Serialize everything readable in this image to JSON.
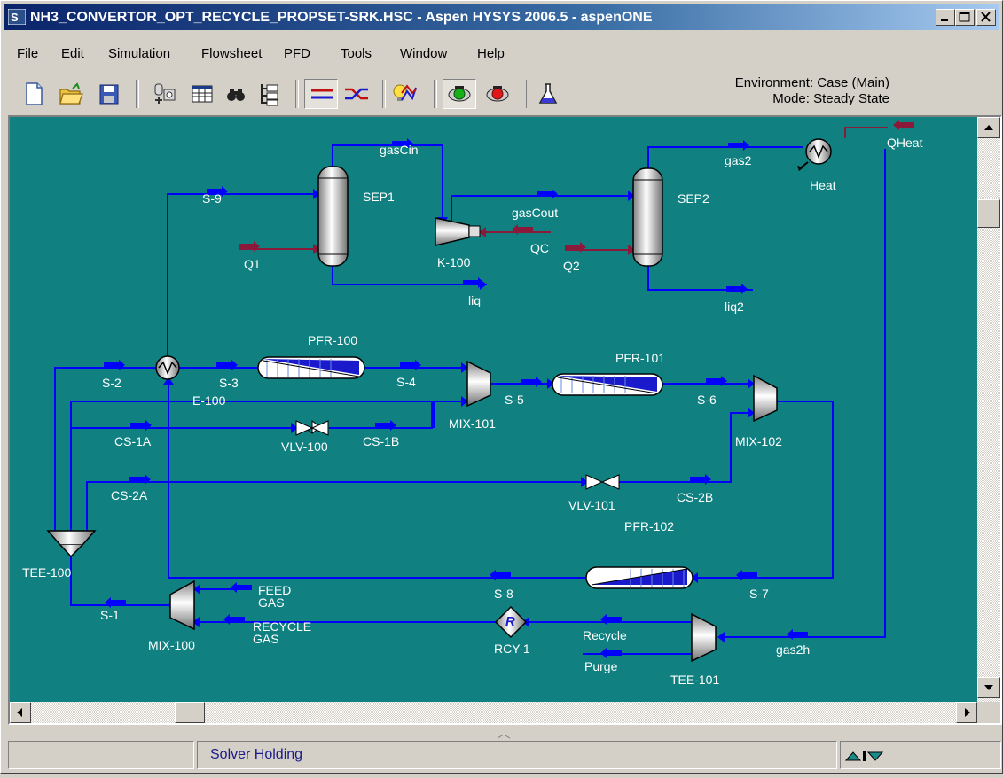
{
  "window": {
    "title": "NH3_CONVERTOR_OPT_RECYCLE_PROPSET-SRK.HSC - Aspen HYSYS 2006.5 - aspenONE",
    "controls": [
      "minimize-icon",
      "maximize-icon",
      "close-icon"
    ]
  },
  "menu": [
    "File",
    "Edit",
    "Simulation",
    "Flowsheet",
    "PFD",
    "Tools",
    "Window",
    "Help"
  ],
  "toolbar": {
    "icons": [
      "new-file-icon",
      "open-folder-icon",
      "save-disk-icon",
      "object-palette-icon",
      "workbook-icon",
      "find-binoculars-icon",
      "navigator-tree-icon",
      "pfd-streams-icon",
      "pfd-crossover-icon",
      "optimizer-icon",
      "solver-active-icon",
      "solver-hold-icon",
      "flask-icon"
    ],
    "environment": "Environment: Case (Main)",
    "mode": "Mode: Steady State"
  },
  "flowsheet": {
    "streams": [
      "gasCin",
      "gas2",
      "QHeat",
      "S-9",
      "SEP1",
      "gasCout",
      "SEP2",
      "Heat",
      "Q1",
      "QC",
      "Q2",
      "K-100",
      "liq",
      "liq2",
      "PFR-100",
      "PFR-101",
      "S-2",
      "S-3",
      "S-4",
      "E-100",
      "S-5",
      "S-6",
      "CS-1A",
      "VLV-100",
      "CS-1B",
      "MIX-101",
      "MIX-102",
      "CS-2A",
      "VLV-101",
      "CS-2B",
      "PFR-102",
      "TEE-100",
      "S-8",
      "S-7",
      "FEED",
      "GAS",
      "S-1",
      "MIX-100",
      "RECYCLE",
      "GAS",
      "RCY-1",
      "Recycle",
      "gas2h",
      "Purge",
      "TEE-101"
    ],
    "recycle_symbol": "R"
  },
  "status": {
    "left": "",
    "message": "Solver Holding",
    "right_icon": "solver-arrows-icon"
  },
  "colors": {
    "canvas": "#108080",
    "material_stream": "#0000ff",
    "energy_stream": "#8b1a3a",
    "title_start": "#0a246a"
  }
}
